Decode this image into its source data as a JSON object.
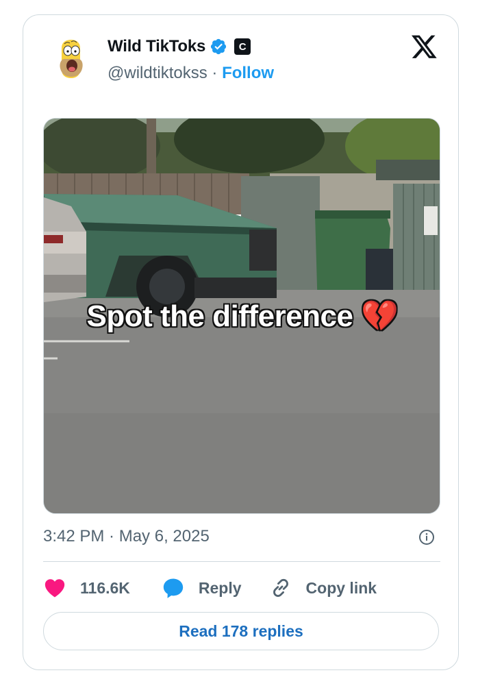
{
  "author": {
    "display_name": "Wild TikToks",
    "handle": "@wildtiktokss",
    "separator": " · ",
    "follow_label": "Follow",
    "affiliation_badge": "C",
    "verified_color": "#1d9bf0"
  },
  "post": {
    "media_caption": "Spot the difference",
    "caption_emoji": "💔",
    "timestamp": "3:42 PM · May 6, 2025"
  },
  "actions": {
    "like_count": "116.6K",
    "reply_label": "Reply",
    "copy_label": "Copy link",
    "read_replies_label": "Read 178 replies"
  },
  "icons": {
    "platform": "x-logo-icon",
    "like": "heart-icon",
    "reply": "speech-bubble-icon",
    "copy": "link-icon",
    "info": "info-icon",
    "verified": "verified-badge-icon"
  },
  "colors": {
    "accent": "#1d9bf0",
    "like": "#f91880",
    "secondary_text": "#536471",
    "border": "#cfd9de"
  }
}
